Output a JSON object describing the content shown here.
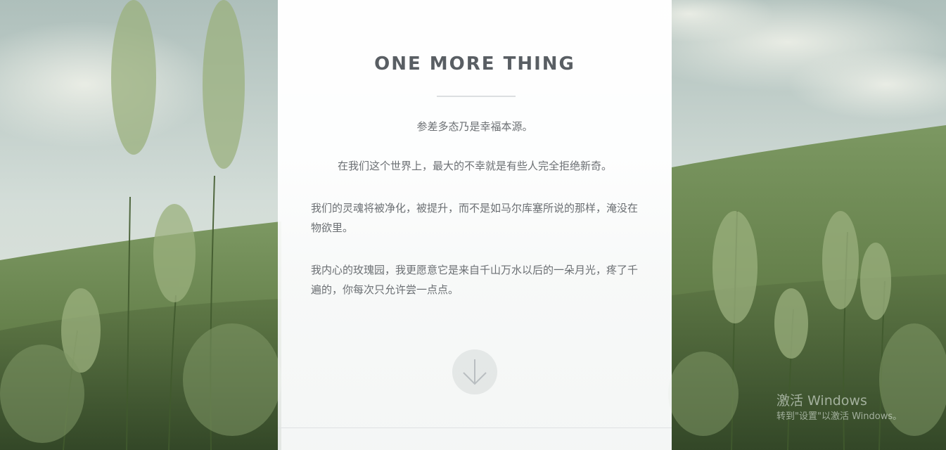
{
  "panel": {
    "title": "ONE MORE THING",
    "paragraphs": [
      "参差多态乃是幸福本源。",
      "在我们这个世界上，最大的不幸就是有些人完全拒绝新奇。",
      "我们的灵魂将被净化，被提升，而不是如马尔库塞所说的那样，淹没在物欲里。",
      "我内心的玫瑰园，我更愿意它是来自千山万水以后的一朵月光，疼了千遍的，你每次只允许尝一点点。"
    ],
    "scroll_icon": "arrow-down-icon"
  },
  "watermark": {
    "title": "激活 Windows",
    "subtitle": "转到\"设置\"以激活 Windows。"
  },
  "colors": {
    "sky": "#c9d6d2",
    "hill": "#6c8a52",
    "grass": "#4f6a3c",
    "title": "#595e63",
    "text": "#6b6f73"
  }
}
